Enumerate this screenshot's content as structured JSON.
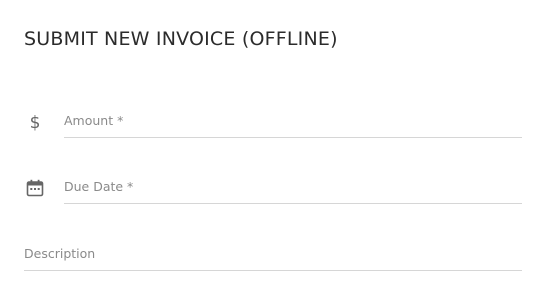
{
  "form": {
    "title": "SUBMIT NEW INVOICE (OFFLINE)",
    "amount": {
      "placeholder": "Amount *",
      "value": "",
      "icon": "dollar-icon"
    },
    "due_date": {
      "placeholder": "Due Date *",
      "value": "",
      "icon": "calendar-icon"
    },
    "description": {
      "placeholder": "Description",
      "value": ""
    }
  },
  "colors": {
    "title": "#2b2b2b",
    "icon": "#666666",
    "placeholder": "#8a8a8a",
    "underline": "#d6d6d6"
  }
}
